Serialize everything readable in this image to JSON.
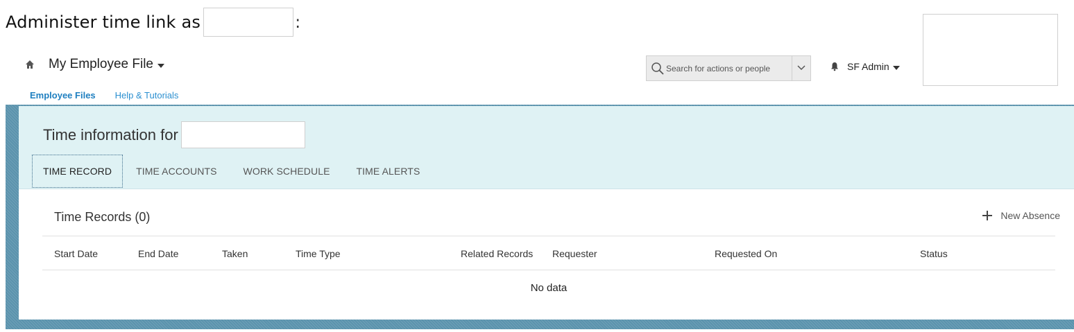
{
  "caption": {
    "text": "Administer time link as",
    "colon": ":"
  },
  "header": {
    "file_title": "My Employee File",
    "search": {
      "placeholder": "Search for actions or people"
    },
    "user": "SF Admin"
  },
  "subnav": {
    "items": [
      {
        "label": "Employee Files",
        "active": true
      },
      {
        "label": "Help & Tutorials",
        "active": false
      }
    ]
  },
  "panel": {
    "time_info_label": "Time information for",
    "tabs": [
      {
        "label": "TIME RECORD",
        "active": true
      },
      {
        "label": "TIME ACCOUNTS",
        "active": false
      },
      {
        "label": "WORK SCHEDULE",
        "active": false
      },
      {
        "label": "TIME ALERTS",
        "active": false
      }
    ]
  },
  "records": {
    "title": "Time Records (0)",
    "new_label": "New Absence",
    "columns": [
      "Start Date",
      "End Date",
      "Taken",
      "Time Type",
      "Related Records",
      "Requester",
      "Requested On",
      "Status"
    ],
    "empty_text": "No data"
  },
  "icons": [
    "home-icon",
    "search-icon",
    "chevron-down-icon",
    "bell-icon",
    "plus-icon"
  ],
  "colors": {
    "link": "#2a8fd0",
    "header_band": "#dff2f4",
    "frame": "#5b93ad"
  }
}
